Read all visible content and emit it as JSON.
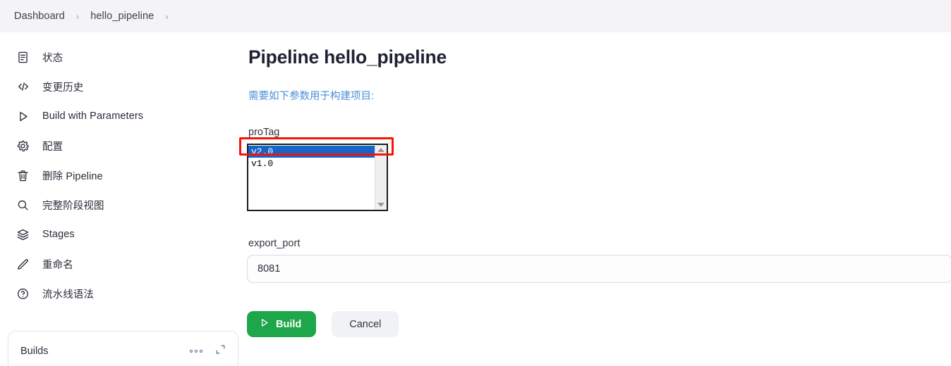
{
  "breadcrumb": {
    "items": [
      {
        "label": "Dashboard"
      },
      {
        "label": "hello_pipeline"
      }
    ],
    "separator": "›"
  },
  "sidebar": {
    "items": [
      {
        "label": "状态",
        "icon": "document-icon"
      },
      {
        "label": "变更历史",
        "icon": "code-icon"
      },
      {
        "label": "Build with Parameters",
        "icon": "play-icon"
      },
      {
        "label": "配置",
        "icon": "gear-icon"
      },
      {
        "label": "删除 Pipeline",
        "icon": "trash-icon"
      },
      {
        "label": "完整阶段视图",
        "icon": "search-icon"
      },
      {
        "label": "Stages",
        "icon": "layers-icon"
      },
      {
        "label": "重命名",
        "icon": "pencil-icon"
      },
      {
        "label": "流水线语法",
        "icon": "question-circle-icon"
      }
    ],
    "builds_card": {
      "title": "Builds",
      "menu_icon": "more-options-icon",
      "expand_icon": "expand-icon"
    }
  },
  "main": {
    "title": "Pipeline hello_pipeline",
    "description": "需要如下参数用于构建项目:",
    "parameters": [
      {
        "name": "proTag",
        "type": "select",
        "options": [
          {
            "value": "v2.0",
            "selected": true
          },
          {
            "value": "v1.0",
            "selected": false
          }
        ],
        "selected_value": "v2.0",
        "annotated": true
      },
      {
        "name": "export_port",
        "type": "text",
        "value": "8081",
        "placeholder": ""
      }
    ],
    "buttons": {
      "build_label": "Build",
      "build_icon": "play-icon",
      "build_color": "#1ea64a",
      "cancel_label": "Cancel"
    }
  },
  "annotation": {
    "color": "#fb1205",
    "target": "proTag option v2.0"
  }
}
